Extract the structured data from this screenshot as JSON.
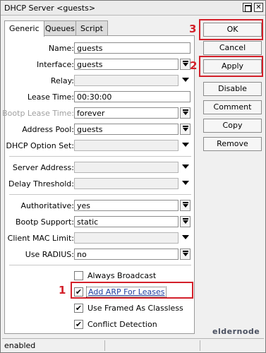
{
  "window": {
    "title": "DHCP Server <guests>"
  },
  "tabs": [
    {
      "label": "Generic"
    },
    {
      "label": "Queues"
    },
    {
      "label": "Script"
    }
  ],
  "fields": {
    "name": {
      "label": "Name:",
      "value": "guests"
    },
    "interface": {
      "label": "Interface:",
      "value": "guests"
    },
    "relay": {
      "label": "Relay:",
      "value": ""
    },
    "lease_time": {
      "label": "Lease Time:",
      "value": "00:30:00"
    },
    "bootp_lease_time": {
      "label": "Bootp Lease Time:",
      "value": "forever"
    },
    "address_pool": {
      "label": "Address Pool:",
      "value": "guests"
    },
    "dhcp_option_set": {
      "label": "DHCP Option Set:",
      "value": ""
    },
    "server_address": {
      "label": "Server Address:",
      "value": ""
    },
    "delay_threshold": {
      "label": "Delay Threshold:",
      "value": ""
    },
    "authoritative": {
      "label": "Authoritative:",
      "value": "yes"
    },
    "bootp_support": {
      "label": "Bootp Support:",
      "value": "static"
    },
    "client_mac_limit": {
      "label": "Client MAC Limit:",
      "value": ""
    },
    "use_radius": {
      "label": "Use RADIUS:",
      "value": "no"
    }
  },
  "checkboxes": [
    {
      "label": "Always Broadcast",
      "checked": false,
      "mark": ""
    },
    {
      "label": "Add ARP For Leases",
      "checked": true,
      "mark": "✔"
    },
    {
      "label": "Use Framed As Classless",
      "checked": true,
      "mark": "✔"
    },
    {
      "label": "Conflict Detection",
      "checked": true,
      "mark": "✔"
    }
  ],
  "buttons": {
    "ok": "OK",
    "cancel": "Cancel",
    "apply": "Apply",
    "disable": "Disable",
    "comment": "Comment",
    "copy": "Copy",
    "remove": "Remove"
  },
  "annotations": {
    "n1": "1",
    "n2": "2",
    "n3": "3",
    "color": "#d3202a"
  },
  "status": {
    "text": "enabled"
  },
  "watermark": "eldernode",
  "icons": {
    "maximize": "maximize-icon",
    "close": "close-icon",
    "dropdown": "dropdown-arrow-icon"
  }
}
